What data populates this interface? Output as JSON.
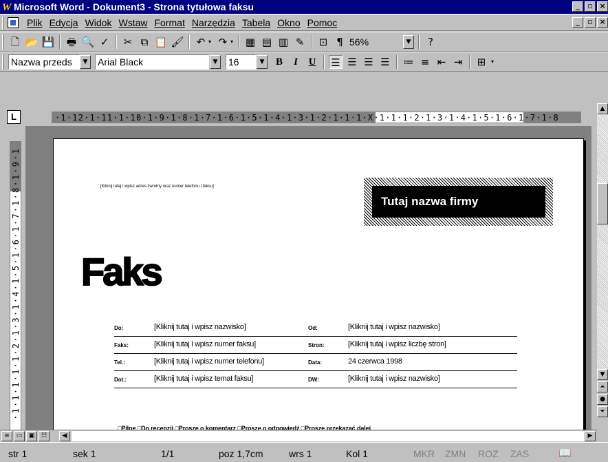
{
  "window": {
    "title": "Microsoft Word - Dokument3 - Strona tytułowa faksu",
    "logo": "W"
  },
  "menu": {
    "items": [
      "Plik",
      "Edycja",
      "Widok",
      "Wstaw",
      "Format",
      "Narzędzia",
      "Tabela",
      "Okno",
      "Pomoc"
    ]
  },
  "toolbar": {
    "zoom": "56%",
    "style": "Nazwa przeds",
    "font": "Arial Black",
    "size": "16",
    "bold": "B",
    "italic": "I",
    "underline": "U",
    "pilcrow": "¶"
  },
  "ruler": {
    "horizontal": "·1·12·1·11·1·10·1·9·1·8·1·7·1·6·1·5·1·4·1·3·1·2·1·1·1·X·1·1·1·2·1·3·1·4·1·5·1·6·1·7·1·8",
    "vertical": "·1·1·1·1·1·2·1·3·1·4·1·5·1·6·1·7·1·8·1·9·1",
    "corner": "L"
  },
  "document": {
    "address": "[Kliknij tutaj i wpisz adres zwrotny oraz numer telefonu i faksu]",
    "company": "Tutaj nazwa firmy",
    "heading": "Faks",
    "fields": [
      {
        "l1": "Do:",
        "v1": "[Kliknij tutaj i wpisz nazwisko]",
        "l2": "Od:",
        "v2": "[Kliknij tutaj i wpisz nazwisko]"
      },
      {
        "l1": "Faks:",
        "v1": "[Kliknij tutaj i wpisz numer faksu]",
        "l2": "Stron:",
        "v2": "[Kliknij tutaj i wpisz  liczbę stron]"
      },
      {
        "l1": "Tel.:",
        "v1": "[Kliknij tutaj i wpisz numer telefonu]",
        "l2": "Data:",
        "v2": "24 czerwca 1998"
      },
      {
        "l1": "Dot.:",
        "v1": "[Kliknij tutaj i wpisz temat faksu]",
        "l2": "DW:",
        "v2": "[Kliknij tutaj i wpisz nazwisko]"
      }
    ],
    "checks": "□Pilne  □Do recenzji  □Proszę o komentarz   □Proszę o odpowiedź  □Proszę przekazać dalej"
  },
  "status": {
    "page": "str 1",
    "section": "sek 1",
    "pages": "1/1",
    "pos": "poz 1,7cm",
    "line": "wrs 1",
    "col": "Kol 1",
    "mkr": "MKR",
    "zmn": "ZMN",
    "roz": "ROZ",
    "zas": "ZAS"
  }
}
